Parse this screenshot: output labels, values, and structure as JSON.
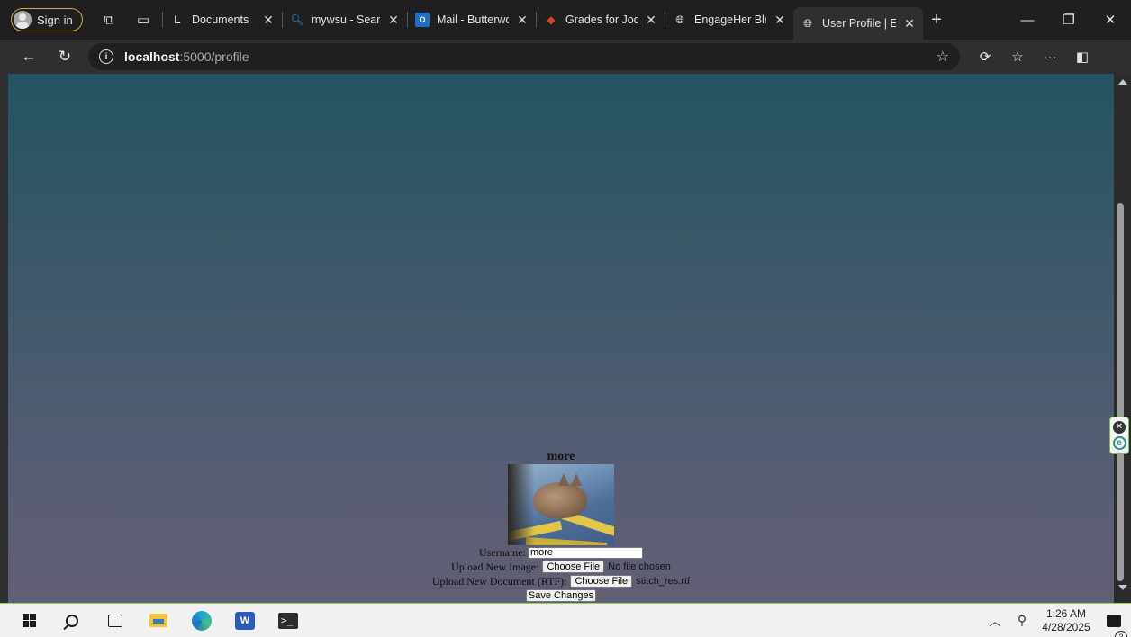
{
  "browser": {
    "profile_button": "Sign in",
    "tabs": [
      {
        "label": "Documents",
        "icon": "documents-favicon"
      },
      {
        "label": "mywsu - Search",
        "icon": "search-favicon"
      },
      {
        "label": "Mail - Butterwor",
        "icon": "outlook-favicon"
      },
      {
        "label": "Grades for Jodie",
        "icon": "canvas-favicon"
      },
      {
        "label": "EngageHer Blog",
        "icon": "globe-favicon"
      },
      {
        "label": "User Profile | En",
        "icon": "globe-favicon",
        "active": true
      }
    ],
    "address": {
      "host": "localhost",
      "path": ":5000/profile"
    }
  },
  "page": {
    "profile_name": "more",
    "username_label": "Username:",
    "username_value": "more",
    "image_label": "Upload New Image:",
    "image_button": "Choose File",
    "image_status": "No file chosen",
    "doc_label": "Upload New Document (RTF):",
    "doc_button": "Choose File",
    "doc_status": "stitch_res.rtf",
    "save_button": "Save Changes",
    "background_top": "#235462",
    "background_bottom": "#625e75"
  },
  "taskbar": {
    "time": "1:26 AM",
    "date": "4/28/2025",
    "notification_count": "3"
  }
}
